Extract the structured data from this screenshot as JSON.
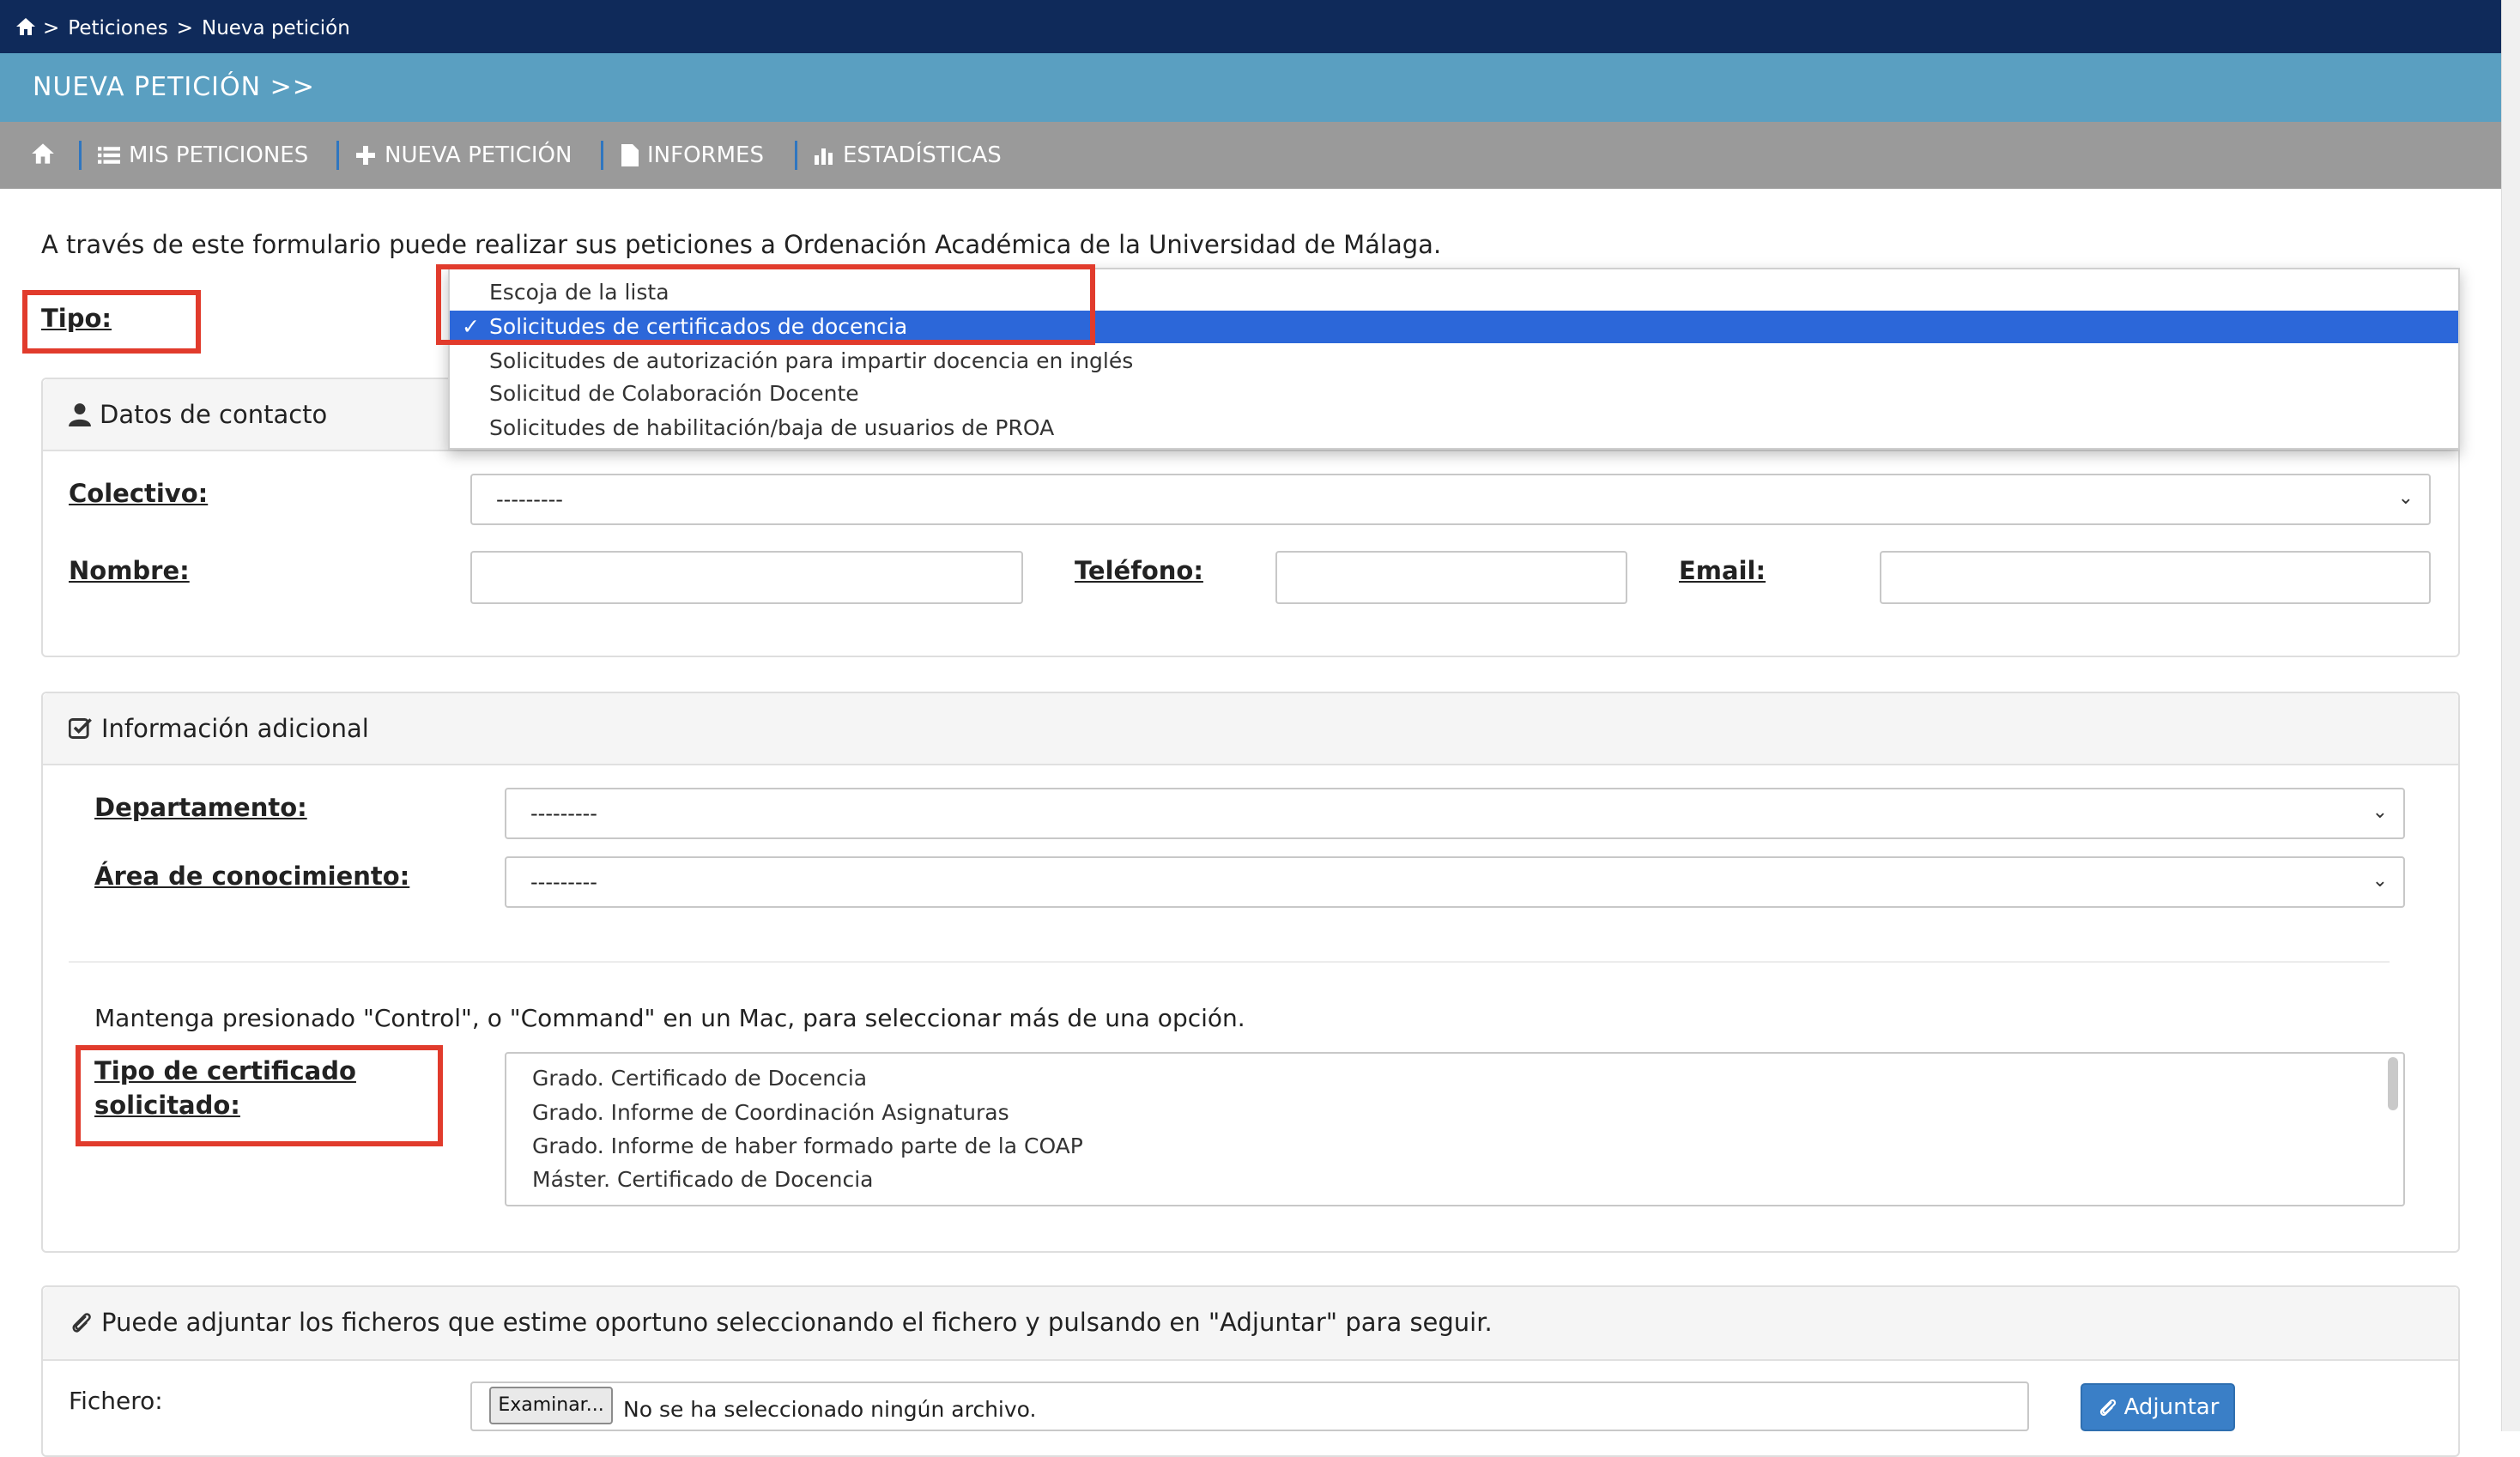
{
  "breadcrumb": {
    "items": [
      "Peticiones",
      "Nueva petición"
    ],
    "separator": ">"
  },
  "page_title": "NUEVA PETICIÓN >>",
  "nav": {
    "home_icon": "home-icon",
    "items": [
      {
        "label": "MIS PETICIONES",
        "icon": "list-icon"
      },
      {
        "label": "NUEVA PETICIÓN",
        "icon": "plus-icon"
      },
      {
        "label": "INFORMES",
        "icon": "file-icon"
      },
      {
        "label": "ESTADÍSTICAS",
        "icon": "bar-chart-icon"
      }
    ]
  },
  "intro_text": "A través de este formulario puede realizar sus peticiones a Ordenación Académica de la Universidad de Málaga.",
  "tipo": {
    "label": "Tipo:",
    "options": [
      "Escoja de la lista",
      "Solicitudes de certificados de docencia",
      "Solicitudes de autorización para impartir docencia en inglés",
      "Solicitud de Colaboración Docente",
      "Solicitudes de habilitación/baja de usuarios de PROA"
    ],
    "selected": "Solicitudes de certificados de docencia",
    "check": "✓"
  },
  "contacto": {
    "title": "Datos de contacto",
    "colectivo_label": "Colectivo:",
    "colectivo_value": "---------",
    "nombre_label": "Nombre:",
    "nombre_value": "",
    "telefono_label": "Teléfono:",
    "telefono_value": "",
    "email_label": "Email:",
    "email_value": ""
  },
  "adicional": {
    "title": "Información adicional",
    "departamento_label": "Departamento:",
    "departamento_value": "---------",
    "area_label": "Área de conocimiento:",
    "area_value": "---------",
    "hint": "Mantenga presionado \"Control\", o \"Command\" en un Mac, para seleccionar más de una opción.",
    "tipo_cert_label_line1": "Tipo de certificado",
    "tipo_cert_label_line2": "solicitado:",
    "tipo_cert_options": [
      "Grado. Certificado de Docencia",
      "Grado. Informe de Coordinación Asignaturas",
      "Grado. Informe de haber formado parte de la COAP",
      "Máster. Certificado de Docencia"
    ]
  },
  "adjuntos": {
    "text": "Puede adjuntar los ficheros que estime oportuno seleccionando el fichero y pulsando en \"Adjuntar\" para seguir.",
    "fichero_label": "Fichero:",
    "examinar_label": "Examinar...",
    "no_file_text": "No se ha seleccionado ningún archivo.",
    "adjuntar_label": "Adjuntar"
  },
  "colors": {
    "topbar": "#0f2a5a",
    "titlebar": "#5a9fc1",
    "navbar": "#9a9a9a",
    "highlight": "#e13b2c",
    "selected_option": "#2c67d9",
    "button": "#3a7fc7"
  }
}
